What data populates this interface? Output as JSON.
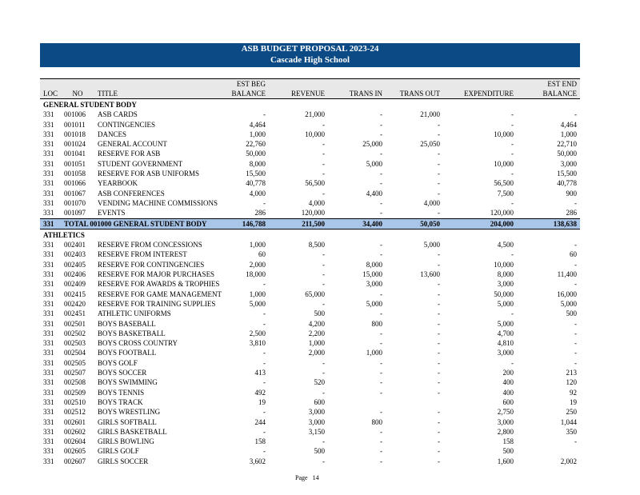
{
  "header": {
    "title": "ASB BUDGET PROPOSAL 2023-24",
    "subtitle": "Cascade High School"
  },
  "columns": {
    "loc": "LOC",
    "no": "NO",
    "title": "TITLE",
    "est_beg_1": "EST BEG",
    "est_beg_2": "BALANCE",
    "revenue": "REVENUE",
    "trans_in": "TRANS IN",
    "trans_out": "TRANS OUT",
    "expenditure": "EXPENDITURE",
    "est_end_1": "EST END",
    "est_end_2": "BALANCE"
  },
  "sections": [
    {
      "name": "GENERAL STUDENT BODY",
      "rows": [
        [
          "331",
          "001006",
          "ASB CARDS",
          "-",
          "21,000",
          "-",
          "21,000",
          "-",
          "-"
        ],
        [
          "331",
          "001011",
          "CONTINGENCIES",
          "4,464",
          "-",
          "-",
          "-",
          "-",
          "4,464"
        ],
        [
          "331",
          "001018",
          "DANCES",
          "1,000",
          "10,000",
          "-",
          "-",
          "10,000",
          "1,000"
        ],
        [
          "331",
          "001024",
          "GENERAL ACCOUNT",
          "22,760",
          "-",
          "25,000",
          "25,050",
          "-",
          "22,710"
        ],
        [
          "331",
          "001041",
          "RESERVE FOR ASB",
          "50,000",
          "-",
          "-",
          "-",
          "-",
          "50,000"
        ],
        [
          "331",
          "001051",
          "STUDENT GOVERNMENT",
          "8,000",
          "-",
          "5,000",
          "-",
          "10,000",
          "3,000"
        ],
        [
          "331",
          "001058",
          "RESERVE FOR ASB UNIFORMS",
          "15,500",
          "-",
          "-",
          "-",
          "-",
          "15,500"
        ],
        [
          "331",
          "001066",
          "YEARBOOK",
          "40,778",
          "56,500",
          "-",
          "-",
          "56,500",
          "40,778"
        ],
        [
          "331",
          "001067",
          "ASB CONFERENCES",
          "4,000",
          "-",
          "4,400",
          "-",
          "7,500",
          "900"
        ],
        [
          "331",
          "001070",
          "VENDING MACHINE COMMISSIONS",
          "-",
          "4,000",
          "-",
          "4,000",
          "-",
          "-"
        ],
        [
          "331",
          "001097",
          "EVENTS",
          "286",
          "120,000",
          "-",
          "-",
          "120,000",
          "286"
        ]
      ],
      "total": [
        "331",
        "TOTAL 001000 GENERAL STUDENT BODY",
        "146,788",
        "211,500",
        "34,400",
        "50,050",
        "204,000",
        "138,638"
      ]
    },
    {
      "name": "ATHLETICS",
      "rows": [
        [
          "331",
          "002401",
          "RESERVE FROM CONCESSIONS",
          "1,000",
          "8,500",
          "-",
          "5,000",
          "4,500",
          "-"
        ],
        [
          "331",
          "002403",
          "RESERVE FROM INTEREST",
          "60",
          "-",
          "-",
          "-",
          "-",
          "60"
        ],
        [
          "331",
          "002405",
          "RESERVE FOR CONTINGENCIES",
          "2,000",
          "-",
          "8,000",
          "-",
          "10,000",
          "-"
        ],
        [
          "331",
          "002406",
          "RESERVE FOR MAJOR PURCHASES",
          "18,000",
          "-",
          "15,000",
          "13,600",
          "8,000",
          "11,400"
        ],
        [
          "331",
          "002409",
          "RESERVE FOR AWARDS & TROPHIES",
          "-",
          "-",
          "3,000",
          "-",
          "3,000",
          "-"
        ],
        [
          "331",
          "002415",
          "RESERVE FOR GAME MANAGEMENT",
          "1,000",
          "65,000",
          "-",
          "-",
          "50,000",
          "16,000"
        ],
        [
          "331",
          "002420",
          "RESERVE FOR TRAINING SUPPLIES",
          "5,000",
          "-",
          "5,000",
          "-",
          "5,000",
          "5,000"
        ],
        [
          "331",
          "002451",
          "ATHLETIC UNIFORMS",
          "-",
          "500",
          "-",
          "-",
          "-",
          "500"
        ],
        [
          "331",
          "002501",
          "BOYS BASEBALL",
          "-",
          "4,200",
          "800",
          "-",
          "5,000",
          "-"
        ],
        [
          "331",
          "002502",
          "BOYS BASKETBALL",
          "2,500",
          "2,200",
          "-",
          "-",
          "4,700",
          "-"
        ],
        [
          "331",
          "002503",
          "BOYS CROSS COUNTRY",
          "3,810",
          "1,000",
          "-",
          "-",
          "4,810",
          "-"
        ],
        [
          "331",
          "002504",
          "BOYS FOOTBALL",
          "-",
          "2,000",
          "1,000",
          "-",
          "3,000",
          "-"
        ],
        [
          "331",
          "002505",
          "BOYS GOLF",
          "-",
          "-",
          "-",
          "-",
          "-",
          "-"
        ],
        [
          "331",
          "002507",
          "BOYS SOCCER",
          "413",
          "-",
          "-",
          "-",
          "200",
          "213"
        ],
        [
          "331",
          "002508",
          "BOYS SWIMMING",
          "-",
          "520",
          "-",
          "-",
          "400",
          "120"
        ],
        [
          "331",
          "002509",
          "BOYS TENNIS",
          "492",
          "-",
          "-",
          "-",
          "400",
          "92"
        ],
        [
          "331",
          "002510",
          "BOYS TRACK",
          "19",
          "600",
          "",
          "",
          "600",
          "19"
        ],
        [
          "331",
          "002512",
          "BOYS WRESTLING",
          "-",
          "3,000",
          "-",
          "-",
          "2,750",
          "250"
        ],
        [
          "331",
          "002601",
          "GIRLS SOFTBALL",
          "244",
          "3,000",
          "800",
          "-",
          "3,000",
          "1,044"
        ],
        [
          "331",
          "002602",
          "GIRLS BASKETBALL",
          "-",
          "3,150",
          "-",
          "-",
          "2,800",
          "350"
        ],
        [
          "331",
          "002604",
          "GIRLS BOWLING",
          "158",
          "-",
          "-",
          "-",
          "158",
          "-"
        ],
        [
          "331",
          "002605",
          "GIRLS GOLF",
          "-",
          "500",
          "-",
          "-",
          "500",
          ""
        ],
        [
          "331",
          "002607",
          "GIRLS SOCCER",
          "3,602",
          "-",
          "-",
          "-",
          "1,600",
          "2,002"
        ]
      ]
    }
  ],
  "footer": {
    "page_label": "Page",
    "page_number": "14"
  }
}
